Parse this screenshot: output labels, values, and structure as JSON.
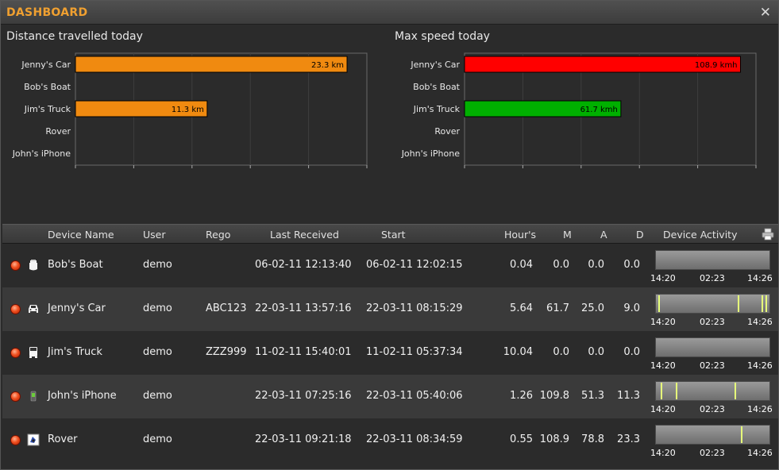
{
  "window": {
    "title": "DASHBOARD",
    "close_label": "✕"
  },
  "charts": {
    "distance": {
      "title": "Distance travelled today"
    },
    "speed": {
      "title": "Max speed today"
    }
  },
  "chart_data": [
    {
      "type": "bar",
      "orientation": "horizontal",
      "title": "Distance travelled today",
      "categories": [
        "Jenny's Car",
        "Bob's Boat",
        "Jim's Truck",
        "Rover",
        "John's iPhone"
      ],
      "values": [
        23.3,
        0,
        11.3,
        0,
        0
      ],
      "value_labels": [
        "23.3 km",
        "",
        "11.3 km",
        "",
        ""
      ],
      "bar_colors": [
        "#f08a10",
        "#f08a10",
        "#f08a10",
        "#f08a10",
        "#f08a10"
      ],
      "xlim": [
        0,
        25
      ],
      "grid": true
    },
    {
      "type": "bar",
      "orientation": "horizontal",
      "title": "Max speed today",
      "categories": [
        "Jenny's Car",
        "Bob's Boat",
        "Jim's Truck",
        "Rover",
        "John's iPhone"
      ],
      "values": [
        108.9,
        0,
        61.7,
        0,
        0
      ],
      "value_labels": [
        "108.9 kmh",
        "",
        "61.7 kmh",
        "",
        ""
      ],
      "bar_colors": [
        "#ff0000",
        "#ff0000",
        "#00b000",
        "#ff0000",
        "#ff0000"
      ],
      "xlim": [
        0,
        115
      ],
      "grid": true
    }
  ],
  "table": {
    "headers": {
      "device": "Device Name",
      "user": "User",
      "rego": "Rego",
      "last": "Last Received",
      "start": "Start",
      "hours": "Hour's",
      "m": "M",
      "a": "A",
      "d": "D",
      "activity": "Device Activity"
    },
    "rows": [
      {
        "icon": "boat-icon",
        "name": "Bob's Boat",
        "user": "demo",
        "rego": "",
        "last": "06-02-11 12:13:40",
        "start": "06-02-11 12:02:15",
        "hours": "0.04",
        "m": "0.0",
        "a": "0.0",
        "d": "0.0",
        "t0": "14:20",
        "t1": "02:23",
        "t2": "14:26",
        "activity": []
      },
      {
        "icon": "car-icon",
        "name": "Jenny's Car",
        "user": "demo",
        "rego": "ABC123",
        "last": "22-03-11 13:57:16",
        "start": "22-03-11 08:15:29",
        "hours": "5.64",
        "m": "61.7",
        "a": "25.0",
        "d": "9.0",
        "t0": "14:20",
        "t1": "02:23",
        "t2": "14:26",
        "activity": [
          0.02,
          0.73,
          0.94,
          0.98
        ]
      },
      {
        "icon": "truck-icon",
        "name": "Jim's Truck",
        "user": "demo",
        "rego": "ZZZ999",
        "last": "11-02-11 15:40:01",
        "start": "11-02-11 05:37:34",
        "hours": "10.04",
        "m": "0.0",
        "a": "0.0",
        "d": "0.0",
        "t0": "14:20",
        "t1": "02:23",
        "t2": "14:26",
        "activity": []
      },
      {
        "icon": "phone-icon",
        "name": "John's iPhone",
        "user": "demo",
        "rego": "",
        "last": "22-03-11 07:25:16",
        "start": "22-03-11 05:40:06",
        "hours": "1.26",
        "m": "109.8",
        "a": "51.3",
        "d": "11.3",
        "t0": "14:20",
        "t1": "02:23",
        "t2": "14:26",
        "activity": [
          0.04,
          0.18,
          0.7
        ]
      },
      {
        "icon": "rover-icon",
        "name": "Rover",
        "user": "demo",
        "rego": "",
        "last": "22-03-11 09:21:18",
        "start": "22-03-11 08:34:59",
        "hours": "0.55",
        "m": "108.9",
        "a": "78.8",
        "d": "23.3",
        "t0": "14:20",
        "t1": "02:23",
        "t2": "14:26",
        "activity": [
          0.76
        ]
      }
    ]
  }
}
